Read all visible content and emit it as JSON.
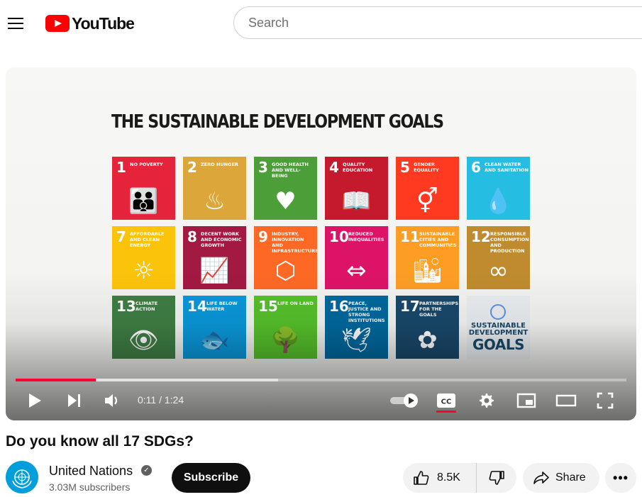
{
  "header": {
    "logo_text": "YouTube",
    "search_placeholder": "Search",
    "search_icon": "search-icon",
    "menu_icon": "hamburger-menu-icon"
  },
  "video_frame": {
    "title": "THE SUSTAINABLE DEVELOPMENT GOALS",
    "goals": [
      {
        "num": "1",
        "label": "NO POVERTY",
        "color": "#e5243b",
        "icon": "👪"
      },
      {
        "num": "2",
        "label": "ZERO HUNGER",
        "color": "#dda63a",
        "icon": "♨"
      },
      {
        "num": "3",
        "label": "GOOD HEALTH AND WELL-BEING",
        "color": "#4c9f38",
        "icon": "♥"
      },
      {
        "num": "4",
        "label": "QUALITY EDUCATION",
        "color": "#c5192d",
        "icon": "📖"
      },
      {
        "num": "5",
        "label": "GENDER EQUALITY",
        "color": "#ff3a21",
        "icon": "⚥"
      },
      {
        "num": "6",
        "label": "CLEAN WATER AND SANITATION",
        "color": "#26bde2",
        "icon": "💧"
      },
      {
        "num": "7",
        "label": "AFFORDABLE AND CLEAN ENERGY",
        "color": "#fcc30b",
        "icon": "☼"
      },
      {
        "num": "8",
        "label": "DECENT WORK AND ECONOMIC GROWTH",
        "color": "#a21942",
        "icon": "📈"
      },
      {
        "num": "9",
        "label": "INDUSTRY, INNOVATION AND INFRASTRUCTURE",
        "color": "#fd6925",
        "icon": "⬡"
      },
      {
        "num": "10",
        "label": "REDUCED INEQUALITIES",
        "color": "#dd1367",
        "icon": "⇔"
      },
      {
        "num": "11",
        "label": "SUSTAINABLE CITIES AND COMMUNITIES",
        "color": "#fd9d24",
        "icon": "🏙"
      },
      {
        "num": "12",
        "label": "RESPONSIBLE CONSUMPTION AND PRODUCTION",
        "color": "#bf8b2e",
        "icon": "∞"
      },
      {
        "num": "13",
        "label": "CLIMATE ACTION",
        "color": "#3f7e44",
        "icon": "👁"
      },
      {
        "num": "14",
        "label": "LIFE BELOW WATER",
        "color": "#0a97d9",
        "icon": "🐟"
      },
      {
        "num": "15",
        "label": "LIFE ON LAND",
        "color": "#56c02b",
        "icon": "🌳"
      },
      {
        "num": "16",
        "label": "PEACE, JUSTICE AND STRONG INSTITUTIONS",
        "color": "#00689d",
        "icon": "🕊"
      },
      {
        "num": "17",
        "label": "PARTNERSHIPS FOR THE GOALS",
        "color": "#19486a",
        "icon": "✿"
      }
    ],
    "logo_tile": {
      "line1": "SUSTAINABLE",
      "line2": "DEVELOPMENT",
      "line3": "GOALS"
    }
  },
  "player": {
    "current_time": "0:11",
    "duration": "1:24",
    "time_display": "0:11 / 1:24",
    "progress_fraction": 0.131,
    "buffered_fraction": 0.43,
    "progress_color": "#ff0033",
    "cc_label": "CC",
    "autoplay_on": true
  },
  "video_info": {
    "title": "Do you know all 17 SDGs?",
    "channel": "United Nations",
    "subscribers": "3.03M subscribers",
    "subscribe_label": "Subscribe",
    "likes": "8.5K",
    "share_label": "Share",
    "more_label": "•••"
  }
}
